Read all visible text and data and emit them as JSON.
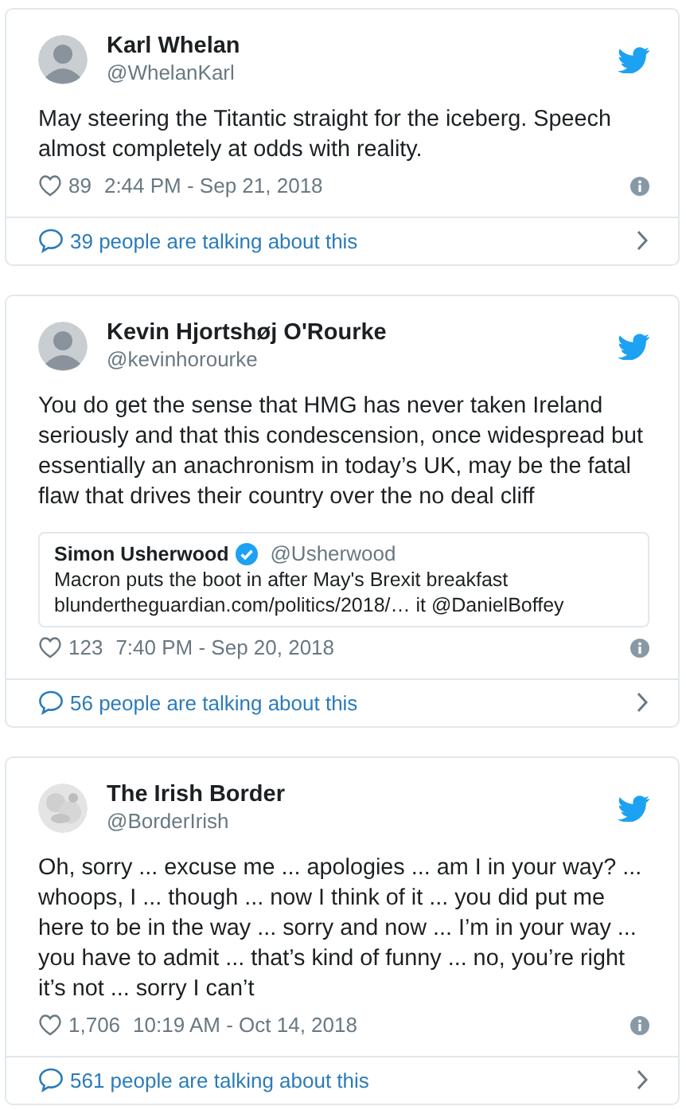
{
  "tweets": [
    {
      "avatar": {
        "kind": "person"
      },
      "name": "Karl Whelan",
      "handle": "@WhelanKarl",
      "text": "May steering the Titantic straight for the iceberg. Speech almost completely at odds with reality.",
      "likes": "89",
      "time": "2:44 PM - Sep 21, 2018",
      "talking": "39 people are talking about this"
    },
    {
      "avatar": {
        "kind": "person"
      },
      "name": "Kevin Hjortshøj O'Rourke",
      "handle": "@kevinhorourke",
      "text": "You do get the sense that HMG has never taken Ireland seriously and that this condescension, once widespread but essentially an anachronism in today’s UK, may be the fatal flaw that drives their country over the no deal cliff",
      "quote": {
        "name": "Simon Usherwood",
        "verified": true,
        "handle": "@Usherwood",
        "line_1": "Macron puts the boot in after May's Brexit breakfast",
        "line_2": "blundertheguardian.com/politics/2018/… it @DanielBoffey"
      },
      "likes": "123",
      "time": "7:40 PM - Sep 20, 2018",
      "talking": "56 people are talking about this"
    },
    {
      "name": "The Irish Border",
      "handle": "@BorderIrish",
      "text": "Oh, sorry ... excuse me ... apologies ... am I in your way? ... whoops, I ... though ... now I think of it ... you did put me here to be in the way ... sorry and now ... I’m in your way ... you have to admit ... that’s kind of funny ... no, you’re right it’s not ... sorry I can’t",
      "likes": "1,706",
      "time": "10:19 AM - Oct 14, 2018",
      "talking": "561 people are talking about this"
    }
  ]
}
